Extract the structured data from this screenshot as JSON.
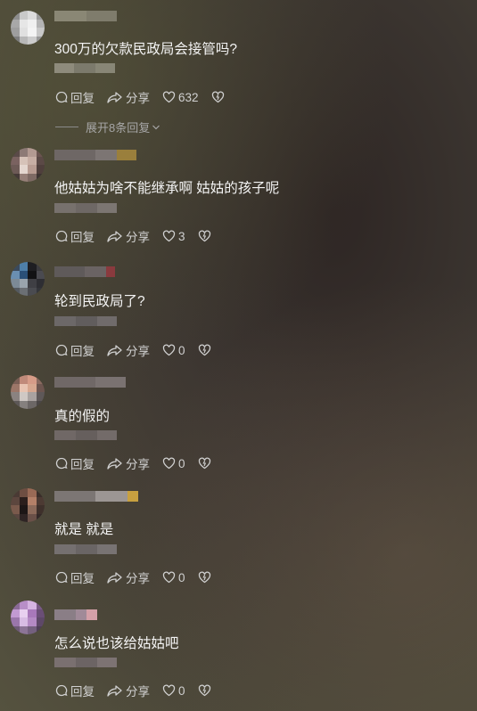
{
  "labels": {
    "reply": "回复",
    "share": "分享"
  },
  "expand_replies": "展开8条回复",
  "comments": [
    {
      "text": "300万的欠款民政局会接管吗?",
      "likes": "632"
    },
    {
      "text": "他姑姑为啥不能继承啊 姑姑的孩子呢",
      "likes": "3"
    },
    {
      "text": "轮到民政局了?",
      "likes": "0"
    },
    {
      "text": "真的假的",
      "likes": "0"
    },
    {
      "text": "就是 就是",
      "likes": "0"
    },
    {
      "text": "怎么说也该给姑姑吧",
      "likes": "0"
    }
  ],
  "colors": {
    "text": "#f3f3f3",
    "action_text": "#d0d0d0",
    "muted": "#a6a6a6"
  },
  "icons": [
    "reply-icon",
    "share-icon",
    "like-icon",
    "dislike-icon",
    "chevron-down-icon"
  ]
}
